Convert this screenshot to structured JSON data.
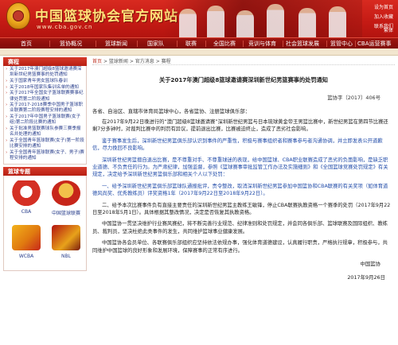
{
  "header": {
    "site_title": "中国篮球协会官方网站",
    "site_url": "www.cba.gov.cn",
    "links": [
      "设为首页",
      "加入收藏",
      "联系我们"
    ],
    "lang": "繁体"
  },
  "nav": [
    "首页",
    "篮协概况",
    "篮球新闻",
    "国家队",
    "联赛",
    "全国比赛",
    "竞训与体育",
    "社会篮球发展",
    "篮管中心",
    "CBA运营赛事"
  ],
  "breadcrumb": [
    "首页",
    "篮球新闻",
    "官方消息",
    "赛程"
  ],
  "sidebar": {
    "title": "赛程",
    "items": [
      "关于2017年澳门超级8篮球邀请赛深圳新世纪男篮赛事的处罚通知",
      "关于国家青年男女篮球队春训",
      "关于2018年国家队集训名单的通知",
      "关于2017年全国女子篮球联赛赛事纪律处罚第二阶段通知",
      "关于2017-2018赛季中国男子篮球职业联赛第二阶段赛程安排的通知",
      "关于2017年中国男子篮球联赛(女子组)第二阶段比赛的通知",
      "关于批准男篮联赛球队参赛三赛季报名并处理的通知",
      "关于全国青年篮球联赛(女子)第一阶段比赛安排的通知",
      "关于全国青年篮球联赛(女子、男子)赛程安排的通知"
    ],
    "teams_title": "篮球专题",
    "teams": [
      "CBA",
      "中国篮球联赛",
      "WCBA",
      "NBL"
    ]
  },
  "article": {
    "title": "关于2017年澳门超级8篮球邀请赛深圳新世纪男篮赛事的处罚通知",
    "doc_number": "篮协字〔2017〕406号",
    "recipient": "各省、自治区、直辖市体育局篮球中心，各省篮协、注册篮球俱乐部：",
    "paragraphs": [
      "在2017年9月22日晚进行的“澳门超级8篮球邀请赛”深圳新世纪男篮与日本琉球黄金帝王男篮比赛中，新世纪男篮在第四节比赛还剩7分多钟时，对裁判比赛中的判罚有异议，提前退出比赛，比赛被迫终止，造成了恶劣社会影响。",
      "鉴于赛事发生后，深圳新世纪男篮俱乐部认识到事件的严重性，积极与赛事组织者和赛事参与者沟通协调，并立即发表公开道歉信，尽力挽回不良影响。",
      "深圳新世纪男篮擅自退出比赛，是不尊重对手、不尊重球迷的表现，给中国篮球、CBA职业联赛造成了恶劣的负面影响，是缺乏职业道德、不负责任的行为。为严肃纪律，加强监督，参照《篮球赛事审批监管工作办法及实施细则》和《全国篮球竞赛处罚规定》有关规定，决定给予深圳新世纪男篮俱乐部和相关个人以下处罚：",
      "一、给予深圳新世纪男篮俱乐部篮球队通报批评，责令整改，取消深圳新世纪男篮参加中国篮协和CBA联赛的有关奖项（如体育道德风尚奖、优秀教练员）评奖资格1年（2017年9月22日至2018年9月22日）。",
      "二、给予本次比赛事件负有直接主要责任的深圳新世纪男篮主教练王敏锋，停止CBA联赛执教资格一个赛季的处罚（2017年9月22日至2018年5月1日）。具体根据其整改情况，决定是否恢复其执教资格。",
      "中国篮协一贯坚决维护行业赛风赛纪，将不断完善行业规范、纪律准则和处罚规定，并会同各俱乐部、篮球联赛及国际组织、教练员、裁判员，坚决杜绝此类事件的发生，共同维护篮球事业健康发展。",
      "中国篮协各会员单位、各联赛俱乐部组织应坚持依法依规办事，强化体育道德建设，认真履行职责，严格执行规章，积极参与，共同维护中国篮球的良好形象和发展环境，保障赛事的正常有序进行。"
    ],
    "signature": "中国篮协",
    "date": "2017年9月26日"
  },
  "colors": {
    "brand_red": "#c41a14",
    "nav_dark": "#7f0b08",
    "link_blue": "#2a3f8c"
  }
}
